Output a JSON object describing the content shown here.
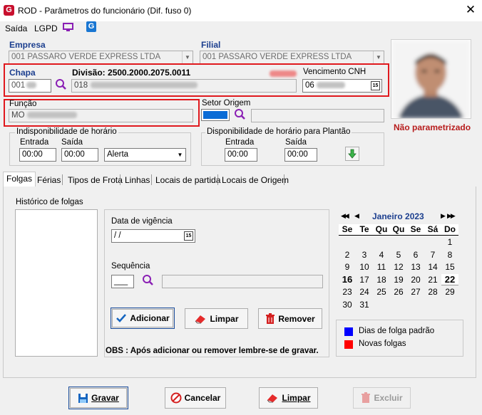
{
  "window": {
    "title": "ROD - Parâmetros do funcionário (Dif. fuso 0)",
    "close_glyph": "✕",
    "logo_glyph": "G"
  },
  "menu": {
    "saida": "Saída",
    "lgpd": "LGPD",
    "app_icon_glyph": "G"
  },
  "empresa": {
    "label": "Empresa",
    "value": "001 PASSARO VERDE EXPRESS LTDA"
  },
  "filial": {
    "label": "Filial",
    "value": "001 PASSARO VERDE EXPRESS LTDA"
  },
  "chapa": {
    "label": "Chapa",
    "value": "001"
  },
  "divisao": {
    "label": "Divisão: 2500.2000.2075.0011",
    "value": "018"
  },
  "vencimento_cnh": {
    "label": "Vencimento CNH",
    "value": "06",
    "cal_glyph": "15"
  },
  "funcao": {
    "label": "Função",
    "value": "MO"
  },
  "setor_origem": {
    "label": "Setor Origem"
  },
  "photo": {
    "status": "Não parametrizado"
  },
  "indisponibilidade": {
    "title": "Indisponibilidade de horário",
    "entrada_label": "Entrada",
    "entrada": "00:00",
    "saida_label": "Saída",
    "saida": "00:00",
    "tipo": "Alerta"
  },
  "disponibilidade": {
    "title": "Disponibilidade de horário para Plantão",
    "entrada_label": "Entrada",
    "entrada": "00:00",
    "saida_label": "Saída",
    "saida": "00:00"
  },
  "tabs": [
    "Folgas",
    "Férias",
    "Tipos de Frota",
    "Linhas",
    "Locais de partida",
    "Locais de Origem"
  ],
  "folgas": {
    "historico_label": "Histórico de folgas",
    "data_vigencia_label": "Data de vigência",
    "data_vigencia_value": " / /",
    "data_cal_glyph": "15",
    "sequencia_label": "Sequência",
    "sequencia_value": "___",
    "btn_adicionar": "Adicionar",
    "btn_limpar": "Limpar",
    "btn_remover": "Remover",
    "obs": "OBS : Após adicionar ou remover lembre-se de gravar."
  },
  "calendar": {
    "month_label": "Janeiro 2023",
    "weekdays": [
      "Se",
      "Te",
      "Qu",
      "Qu",
      "Se",
      "Sá",
      "Do"
    ],
    "weeks": [
      [
        "",
        "",
        "",
        "",
        "",
        "",
        "1"
      ],
      [
        "2",
        "3",
        "4",
        "5",
        "6",
        "7",
        "8"
      ],
      [
        "9",
        "10",
        "11",
        "12",
        "13",
        "14",
        "15"
      ],
      [
        "16",
        "17",
        "18",
        "19",
        "20",
        "21",
        "22"
      ],
      [
        "23",
        "24",
        "25",
        "26",
        "27",
        "28",
        "29"
      ],
      [
        "30",
        "31",
        "",
        "",
        "",
        "",
        ""
      ]
    ],
    "bold_days": [
      "16",
      "22"
    ],
    "nav_first": "◀◀",
    "nav_prev": "◀",
    "nav_next": "▶",
    "nav_last": "▶▶"
  },
  "legend": {
    "padrao_label": "Dias de folga padrão",
    "padrao_color": "#0000ff",
    "novas_label": "Novas folgas",
    "novas_color": "#ff0000"
  },
  "footer": {
    "gravar": "Gravar",
    "cancelar": "Cancelar",
    "limpar": "Limpar",
    "excluir": "Excluir"
  },
  "colors": {
    "label_blue": "#1c3f8f",
    "highlight_red": "#e0191e",
    "status_red": "#b71c1c",
    "setor_blue": "#0a6cd6"
  }
}
